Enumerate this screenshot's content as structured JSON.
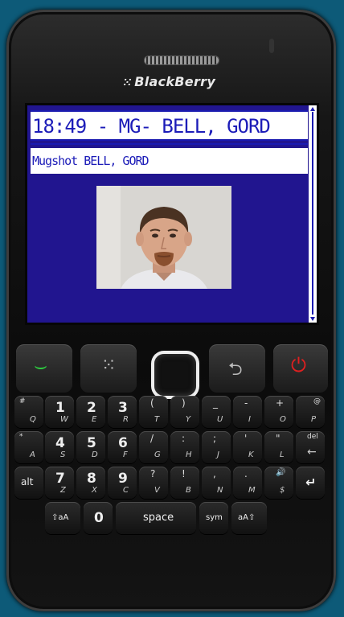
{
  "device": {
    "brand": "BlackBerry",
    "logo_glyph": "⁙"
  },
  "screen": {
    "title": "18:49 - MG- BELL, GORD",
    "subtitle": "Mugshot BELL, GORD"
  },
  "nav_keys": [
    {
      "name": "call-key",
      "glyph": "⌣",
      "color": "#2ecc40"
    },
    {
      "name": "menu-key",
      "glyph": "⁙",
      "color": "#bbbbbb"
    },
    {
      "name": "back-key",
      "glyph": "⮌",
      "color": "#bbbbbb"
    },
    {
      "name": "end-key",
      "glyph": "⏻",
      "color": "#e02020"
    }
  ],
  "keyboard": {
    "row1": [
      {
        "sym": "#",
        "main": "Q",
        "sub": ""
      },
      {
        "sym": "",
        "main": "1",
        "sub": "W"
      },
      {
        "sym": "",
        "main": "2",
        "sub": "E"
      },
      {
        "sym": "",
        "main": "3",
        "sub": "R"
      },
      {
        "sym": "(",
        "main": "",
        "sub": "T"
      },
      {
        "sym": ")",
        "main": "",
        "sub": "Y"
      },
      {
        "sym": "_",
        "main": "",
        "sub": "U"
      },
      {
        "sym": "-",
        "main": "",
        "sub": "I"
      },
      {
        "sym": "+",
        "main": "",
        "sub": "O"
      },
      {
        "sym": "@",
        "main": "",
        "sub": "P"
      }
    ],
    "row2": [
      {
        "sym": "*",
        "main": "",
        "sub": "A"
      },
      {
        "sym": "",
        "main": "4",
        "sub": "S"
      },
      {
        "sym": "",
        "main": "5",
        "sub": "D"
      },
      {
        "sym": "",
        "main": "6",
        "sub": "F"
      },
      {
        "sym": "/",
        "main": "",
        "sub": "G"
      },
      {
        "sym": ":",
        "main": "",
        "sub": "H"
      },
      {
        "sym": ";",
        "main": "",
        "sub": "J"
      },
      {
        "sym": "'",
        "main": "",
        "sub": "K"
      },
      {
        "sym": "\"",
        "main": "",
        "sub": "L"
      },
      {
        "sym": "del",
        "main": "",
        "sub": "←"
      }
    ],
    "row3": [
      {
        "sym": "",
        "main": "alt",
        "sub": ""
      },
      {
        "sym": "",
        "main": "7",
        "sub": "Z"
      },
      {
        "sym": "",
        "main": "8",
        "sub": "X"
      },
      {
        "sym": "",
        "main": "9",
        "sub": "C"
      },
      {
        "sym": "?",
        "main": "",
        "sub": "V"
      },
      {
        "sym": "!",
        "main": "",
        "sub": "B"
      },
      {
        "sym": ",",
        "main": "",
        "sub": "N"
      },
      {
        "sym": ".",
        "main": "",
        "sub": "M"
      },
      {
        "sym": "🔊",
        "main": "",
        "sub": "$"
      },
      {
        "sym": "",
        "main": "↵",
        "sub": ""
      }
    ],
    "row4": [
      {
        "label": "⇧aA"
      },
      {
        "label": "0"
      },
      {
        "label": "space"
      },
      {
        "label": "sym"
      },
      {
        "label": "aA⇧"
      }
    ]
  }
}
